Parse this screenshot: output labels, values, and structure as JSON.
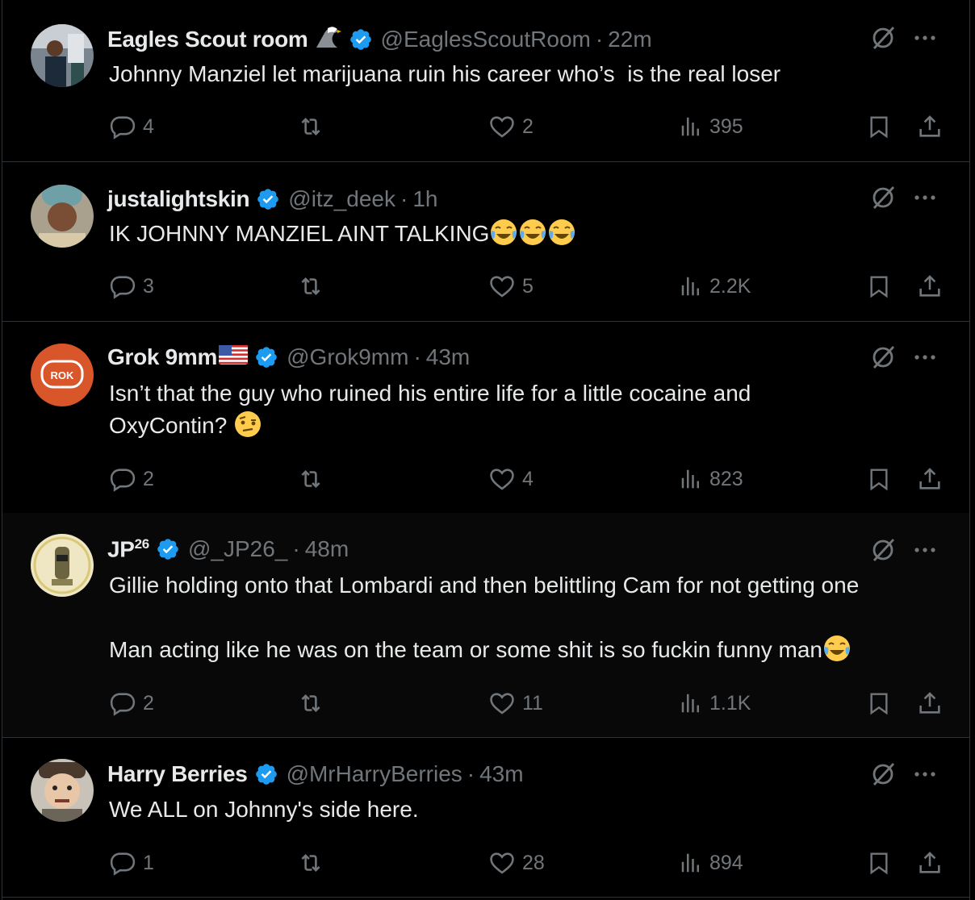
{
  "tweets": [
    {
      "name": "Eagles Scout room",
      "name_emoji": "eagle",
      "handle": "@EaglesScoutRoom",
      "time": "22m",
      "text_parts": [
        "Johnny Manziel let marijuana ruin his career who’s  is the real loser"
      ],
      "replies": "4",
      "likes": "2",
      "views": "395"
    },
    {
      "name": "justalightskin",
      "handle": "@itz_deek",
      "time": "1h",
      "text_parts": [
        "IK JOHNNY MANZIEL AINT TALKING"
      ],
      "text_emoji": [
        "laughing-tears",
        "laughing-tears",
        "laughing-tears"
      ],
      "replies": "3",
      "likes": "5",
      "views": "2.2K"
    },
    {
      "name": "Grok 9mm",
      "name_emoji": "us-flag",
      "handle": "@Grok9mm",
      "time": "43m",
      "text_parts": [
        "Isn’t that the guy who ruined his entire life for a little cocaine and",
        "OxyContin? "
      ],
      "text_emoji": [
        "raised-eyebrow-face"
      ],
      "replies": "2",
      "likes": "4",
      "views": "823"
    },
    {
      "name": "JP",
      "name_sup": "26",
      "handle": "@_JP26_",
      "time": "48m",
      "text_parts": [
        "Gillie holding onto that Lombardi and then belittling Cam for not getting one",
        "",
        "Man acting like he was on the team or some shit is so fuckin funny man"
      ],
      "text_emoji": [
        "laughing-tears"
      ],
      "replies": "2",
      "likes": "11",
      "views": "1.1K"
    },
    {
      "name": "Harry Berries",
      "handle": "@MrHarryBerries",
      "time": "43m",
      "text_parts": [
        "We ALL on Johnny's side here."
      ],
      "replies": "1",
      "likes": "28",
      "views": "894"
    }
  ],
  "separator": "·",
  "icons": [
    "reply-icon",
    "repost-icon",
    "like-icon",
    "views-icon",
    "bookmark-icon",
    "share-icon",
    "grok-icon",
    "more-icon",
    "verified-badge-icon"
  ],
  "colors": {
    "background": "#000000",
    "text": "#e7e9ea",
    "muted": "#71767b",
    "border": "#2f3336",
    "verified": "#1d9bf0"
  }
}
